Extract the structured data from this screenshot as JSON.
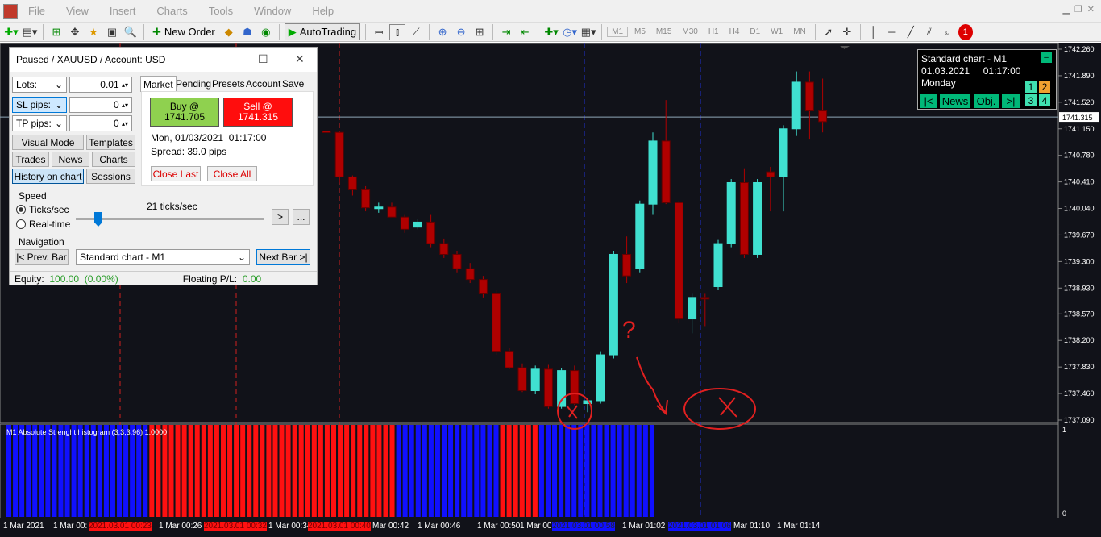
{
  "menu": [
    "File",
    "View",
    "Insert",
    "Charts",
    "Tools",
    "Window",
    "Help"
  ],
  "toolbar": {
    "new_order": "New Order",
    "autotrading": "AutoTrading",
    "timeframes": [
      "M1",
      "M5",
      "M15",
      "M30",
      "H1",
      "H4",
      "D1",
      "W1",
      "MN"
    ]
  },
  "panel": {
    "title": "Paused / XAUUSD / Account: USD",
    "lots_label": "Lots:",
    "lots_value": "0.01",
    "sl_label": "SL pips:",
    "sl_value": "0",
    "tp_label": "TP pips:",
    "tp_value": "0",
    "tabs": [
      "Market",
      "Pending",
      "Presets",
      "Account",
      "Save"
    ],
    "buy_label": "Buy @",
    "buy_price": "1741.705",
    "sell_label": "Sell @",
    "sell_price": "1741.315",
    "date": "Mon, 01/03/2021",
    "time": "01:17:00",
    "spread": "Spread:  39.0 pips",
    "close_last": "Close Last",
    "close_all": "Close All",
    "btn_visual": "Visual Mode",
    "btn_templates": "Templates",
    "btn_trades": "Trades",
    "btn_news": "News",
    "btn_charts": "Charts",
    "btn_history": "History on chart",
    "btn_sessions": "Sessions",
    "speed_label": "Speed",
    "ticks_sec": "Ticks/sec",
    "realtime": "Real-time",
    "ticks_value": "21 ticks/sec",
    "speed_fraction": 0.12,
    "nav_label": "Navigation",
    "prev_bar": "|< Prev. Bar",
    "chart_select": "Standard chart - M1",
    "next_bar": "Next Bar >|",
    "equity_label": "Equity:",
    "equity_value": "100.00",
    "equity_pct": "(0.00%)",
    "pl_label": "Floating P/L:",
    "pl_value": "0.00",
    "fwd": ">",
    "dots": "..."
  },
  "stdbox": {
    "line1": "Standard chart - M1",
    "date": "01.03.2021",
    "time": "01:17:00",
    "day": "Monday",
    "b_first": "|<",
    "b_news": "News",
    "b_obj": "Obj.",
    "b_last": ">|",
    "n1": "1",
    "n2": "2",
    "n3": "3",
    "n4": "4"
  },
  "indicator_label": "M1 Absolute Strenght histogram (3,3,3,96) 1.0000",
  "indicator_scale": [
    "1",
    "0"
  ],
  "price_ticks": [
    "1742.260",
    "1741.890",
    "1741.520",
    "1741.150",
    "1740.780",
    "1740.410",
    "1740.040",
    "1739.670",
    "1739.300",
    "1738.930",
    "1738.570",
    "1738.200",
    "1737.830",
    "1737.460",
    "1737.090"
  ],
  "current_price": "1741.315",
  "x_labels": [
    "1 Mar 2021",
    "1 Mar 00:",
    "1 Mar 00:26",
    "1 Mar 00:34",
    "Mar 00:42",
    "1 Mar 00:46",
    "1 Mar 00:50",
    "1 Mar 00:",
    "1 Mar 01:02",
    "Mar 01:10",
    "1 Mar 01:14"
  ],
  "x_red_tags": [
    "2021.03.01 00:23",
    "2021.03.01 00:32",
    "2021.03.01 00:40"
  ],
  "x_blue_tags": [
    "2021.03.01 00:58",
    "2021.03.01 01:06"
  ],
  "colors": {
    "bull": "#40e0d0",
    "bear": "#b00000",
    "hist_red": "#ff1010",
    "hist_blue": "#1010ff",
    "bg": "#111219"
  },
  "chart_data": {
    "type": "candlestick",
    "ohlc": [
      [
        1741.12,
        1741.12,
        1741.1,
        1741.1
      ],
      [
        1741.1,
        1741.12,
        1740.4,
        1740.48
      ],
      [
        1740.48,
        1740.5,
        1740.22,
        1740.3
      ],
      [
        1740.3,
        1740.35,
        1740.0,
        1740.05
      ],
      [
        1740.05,
        1740.12,
        1739.98,
        1740.06
      ],
      [
        1740.06,
        1740.12,
        1739.95,
        1739.92
      ],
      [
        1739.92,
        1739.95,
        1739.7,
        1739.75
      ],
      [
        1739.78,
        1739.9,
        1739.75,
        1739.85
      ],
      [
        1739.85,
        1739.95,
        1739.5,
        1739.55
      ],
      [
        1739.55,
        1739.62,
        1739.35,
        1739.4
      ],
      [
        1739.4,
        1739.45,
        1739.15,
        1739.2
      ],
      [
        1739.2,
        1739.28,
        1739.0,
        1739.05
      ],
      [
        1739.05,
        1739.1,
        1738.8,
        1738.85
      ],
      [
        1738.85,
        1738.9,
        1738.0,
        1738.05
      ],
      [
        1738.05,
        1738.1,
        1737.8,
        1737.82
      ],
      [
        1737.82,
        1737.88,
        1737.48,
        1737.5
      ],
      [
        1737.5,
        1737.85,
        1737.45,
        1737.8
      ],
      [
        1737.8,
        1737.86,
        1737.25,
        1737.28
      ],
      [
        1737.28,
        1737.82,
        1737.25,
        1737.78
      ],
      [
        1737.78,
        1737.85,
        1737.3,
        1737.32
      ],
      [
        1737.32,
        1737.4,
        1737.2,
        1737.36
      ],
      [
        1737.36,
        1738.05,
        1737.32,
        1738.0
      ],
      [
        1738.0,
        1739.45,
        1737.95,
        1739.4
      ],
      [
        1739.4,
        1739.65,
        1739.0,
        1739.1
      ],
      [
        1739.2,
        1740.15,
        1739.15,
        1740.1
      ],
      [
        1740.1,
        1741.1,
        1739.95,
        1740.98
      ],
      [
        1740.98,
        1741.55,
        1740.1,
        1740.12
      ],
      [
        1740.12,
        1740.15,
        1738.45,
        1738.5
      ],
      [
        1738.5,
        1738.85,
        1738.3,
        1738.8
      ],
      [
        1738.8,
        1738.85,
        1738.4,
        1738.78
      ],
      [
        1738.95,
        1739.6,
        1738.9,
        1739.55
      ],
      [
        1739.55,
        1740.45,
        1739.5,
        1740.4
      ],
      [
        1740.4,
        1740.6,
        1739.35,
        1739.4
      ],
      [
        1739.4,
        1740.45,
        1739.35,
        1740.4
      ],
      [
        1740.55,
        1740.62,
        1740.0,
        1740.48
      ],
      [
        1740.48,
        1741.2,
        1740.0,
        1741.15
      ],
      [
        1741.15,
        1741.95,
        1741.05,
        1741.8
      ],
      [
        1741.8,
        1741.95,
        1741.0,
        1741.4
      ],
      [
        1741.4,
        1741.85,
        1741.1,
        1741.25
      ]
    ],
    "histogram": [
      "b",
      "b",
      "b",
      "b",
      "b",
      "b",
      "b",
      "b",
      "b",
      "b",
      "b",
      "b",
      "b",
      "b",
      "b",
      "b",
      "b",
      "b",
      "b",
      "b",
      "b",
      "b",
      "r",
      "r",
      "r",
      "r",
      "r",
      "r",
      "r",
      "r",
      "r",
      "r",
      "r",
      "r",
      "r",
      "r",
      "r",
      "r",
      "r",
      "r",
      "r",
      "r",
      "r",
      "r",
      "r",
      "r",
      "r",
      "r",
      "r",
      "r",
      "r",
      "r",
      "r",
      "r",
      "r",
      "r",
      "r",
      "r",
      "r",
      "r",
      "b",
      "b",
      "b",
      "b",
      "b",
      "b",
      "b",
      "b",
      "b",
      "b",
      "b",
      "b",
      "b",
      "b",
      "b",
      "b",
      "r",
      "r",
      "r",
      "r",
      "r",
      "r",
      "b",
      "b",
      "b",
      "b",
      "b",
      "b",
      "b",
      "b",
      "b",
      "b",
      "b",
      "b",
      "b",
      "b",
      "b",
      "b",
      "b",
      "b"
    ],
    "ylim": [
      1737.09,
      1742.26
    ]
  },
  "annotations": {
    "question": "?"
  }
}
